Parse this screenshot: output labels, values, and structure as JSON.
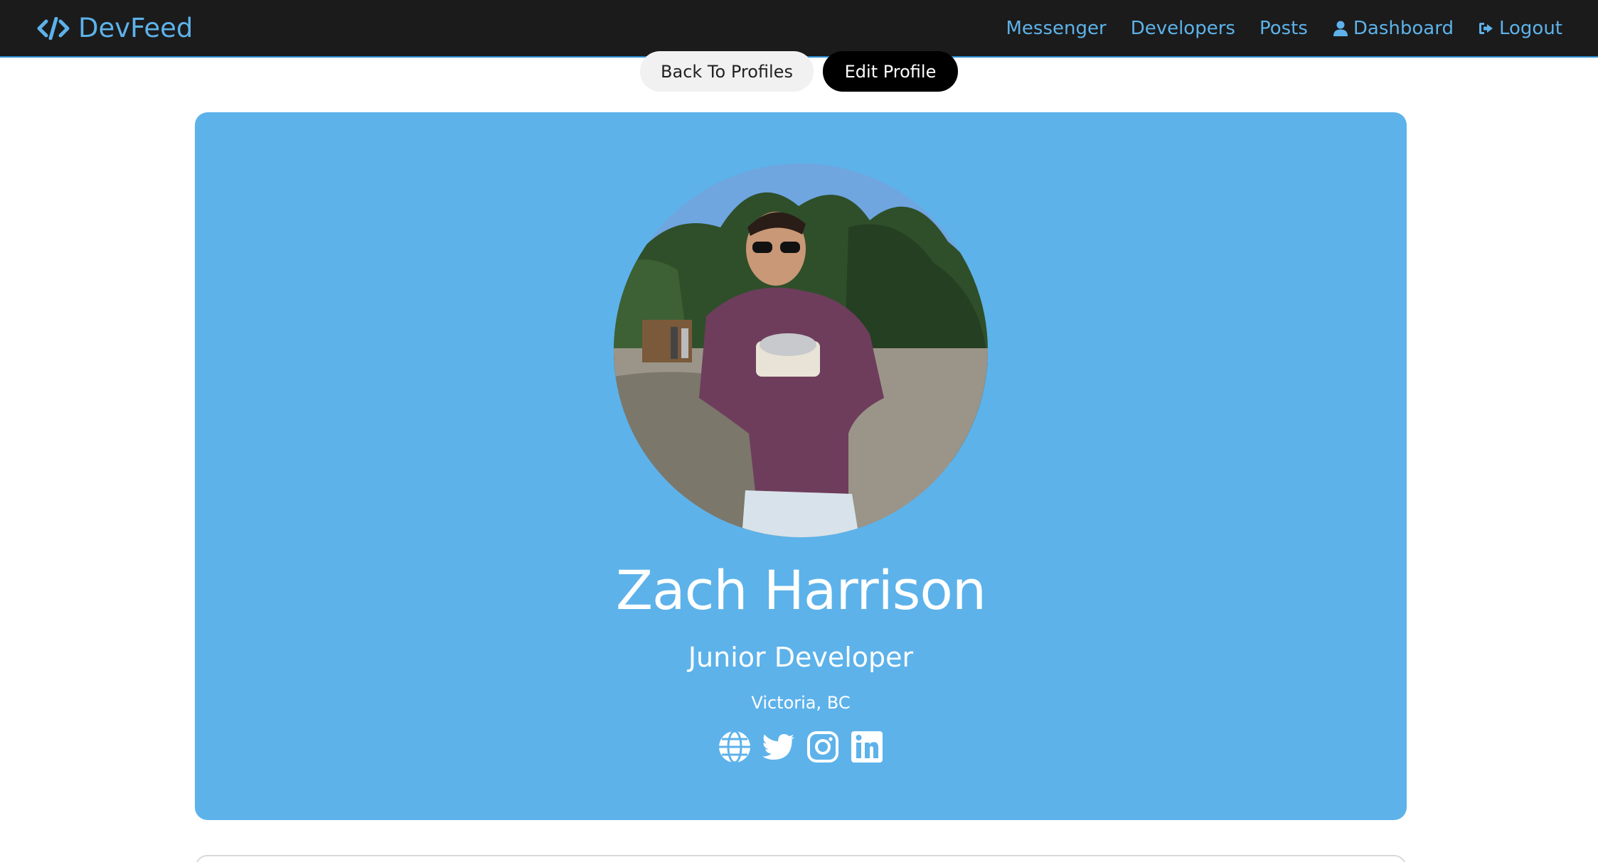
{
  "navbar": {
    "brand": "DevFeed",
    "links": {
      "messenger": "Messenger",
      "developers": "Developers",
      "posts": "Posts",
      "dashboard": "Dashboard",
      "logout": "Logout"
    }
  },
  "actions": {
    "back": "Back To Profiles",
    "edit": "Edit Profile"
  },
  "profile": {
    "name": "Zach Harrison",
    "title": "Junior Developer",
    "location": "Victoria, BC",
    "social_icons": [
      "globe-icon",
      "twitter-icon",
      "instagram-icon",
      "linkedin-icon"
    ]
  },
  "colors": {
    "accent": "#5db2ea",
    "navbar_bg": "#1b1b1b",
    "dark_button": "#000000",
    "light_button": "#f1f1f1"
  }
}
